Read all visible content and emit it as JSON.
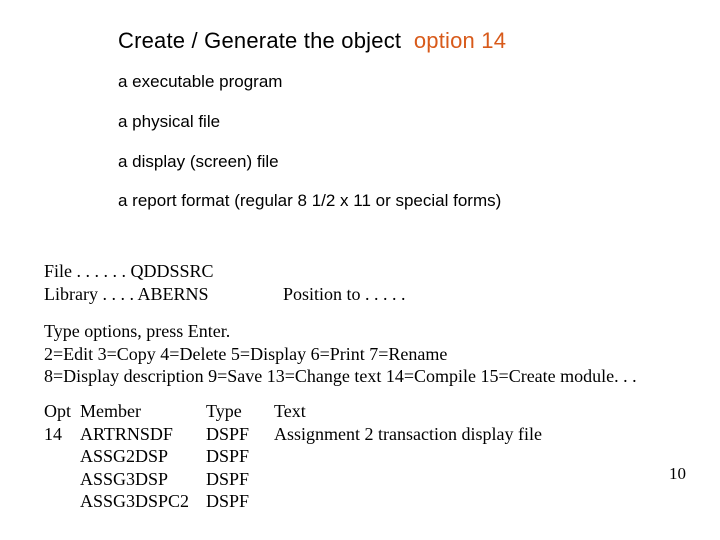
{
  "title": {
    "main": "Create / Generate the object",
    "option": "option 14"
  },
  "bullets": {
    "b0": "a executable program",
    "b1": "a physical file",
    "b2": "a display (screen) file",
    "b3": "a report format (regular 8 1/2 x 11 or  special forms)"
  },
  "file": {
    "line1": "File  . . . . . .   QDDSSRC",
    "line2_label": "  Library . . . .    ABERNS",
    "position_to": "Position to  . . . . ."
  },
  "options": {
    "line1": "Type options, press Enter.",
    "line2": " 2=Edit          3=Copy  4=Delete  5=Display        6=Print      7=Rename",
    "line3": "8=Display description  9=Save  13=Change text  14=Compile  15=Create module. . ."
  },
  "members": {
    "header": {
      "opt": "Opt",
      "member": "Member",
      "type": "Type",
      "text": "Text"
    },
    "rows": [
      {
        "opt": "14",
        "member": "ARTRNSDF",
        "type": "DSPF",
        "text": "Assignment 2  transaction display file"
      },
      {
        "opt": "",
        "member": "ASSG2DSP",
        "type": "DSPF",
        "text": ""
      },
      {
        "opt": "",
        "member": "ASSG3DSP",
        "type": "DSPF",
        "text": ""
      },
      {
        "opt": "",
        "member": "ASSG3DSPC2",
        "type": "DSPF",
        "text": ""
      }
    ]
  },
  "page_number": "10"
}
